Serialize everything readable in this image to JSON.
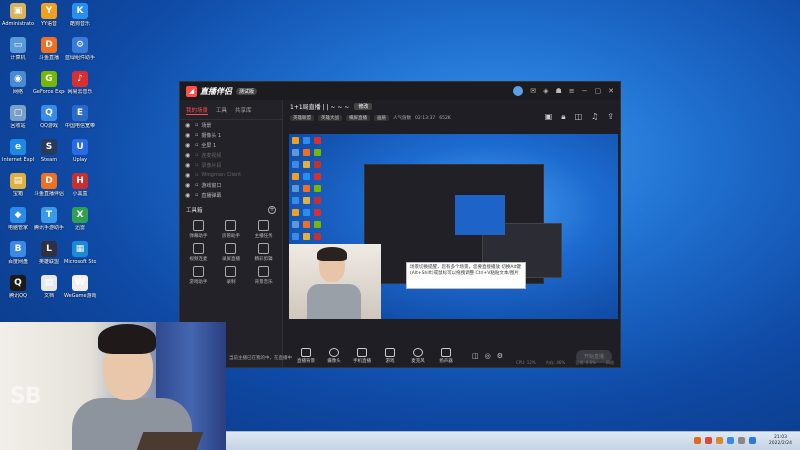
{
  "desktop_icons": [
    {
      "label": "Administrator",
      "color": "#d9b45a",
      "glyph": "▣"
    },
    {
      "label": "YY语音",
      "color": "#f0a020",
      "glyph": "Y"
    },
    {
      "label": "酷狗音乐",
      "color": "#2a8ef0",
      "glyph": "K"
    },
    {
      "label": "计算机",
      "color": "#5a9ad8",
      "glyph": "▭"
    },
    {
      "label": "斗鱼直播",
      "color": "#f07020",
      "glyph": "D"
    },
    {
      "label": "蓝绿组件助手",
      "color": "#3a7ad8",
      "glyph": "⚙"
    },
    {
      "label": "网络",
      "color": "#4a8ad0",
      "glyph": "◉"
    },
    {
      "label": "GeForce Experience",
      "color": "#76b900",
      "glyph": "G"
    },
    {
      "label": "网易云音乐",
      "color": "#d83030",
      "glyph": "♪"
    },
    {
      "label": "回收站",
      "color": "#7aa0c8",
      "glyph": "▢"
    },
    {
      "label": "QQ游戏",
      "color": "#3a8ae8",
      "glyph": "Q"
    },
    {
      "label": "中国电信宽带",
      "color": "#2a6ac8",
      "glyph": "E"
    },
    {
      "label": "Internet Explorer",
      "color": "#1e88e5",
      "glyph": "e"
    },
    {
      "label": "Steam",
      "color": "#2a3a5a",
      "glyph": "S"
    },
    {
      "label": "Uplay",
      "color": "#2a6ae8",
      "glyph": "U"
    },
    {
      "label": "宝箱",
      "color": "#e0b040",
      "glyph": "▤"
    },
    {
      "label": "斗鱼直播伴侣",
      "color": "#f07020",
      "glyph": "D"
    },
    {
      "label": "小黑盒",
      "color": "#c83030",
      "glyph": "H"
    },
    {
      "label": "电脑管家",
      "color": "#2a8ae8",
      "glyph": "◆"
    },
    {
      "label": "腾讯手游助手",
      "color": "#3a9ae8",
      "glyph": "T"
    },
    {
      "label": "迅雷",
      "color": "#30a050",
      "glyph": "X"
    },
    {
      "label": "百度网盘",
      "color": "#3a8ae8",
      "glyph": "B"
    },
    {
      "label": "英雄联盟",
      "color": "#303040",
      "glyph": "L"
    },
    {
      "label": "Microsoft Store",
      "color": "#1a8ad8",
      "glyph": "▦"
    },
    {
      "label": "腾讯QQ",
      "color": "#1a1a1a",
      "glyph": "Q"
    },
    {
      "label": "文档",
      "color": "#e8e8e8",
      "glyph": "▤"
    },
    {
      "label": "WeGame游戏",
      "color": "#f0f0f0",
      "glyph": "W"
    }
  ],
  "app": {
    "name": "直播伴侣",
    "version": "测试版",
    "left_tabs": [
      "我的场景",
      "工具",
      "共享库"
    ],
    "scenes": [
      {
        "label": "场景",
        "dim": false
      },
      {
        "label": "摄像头 1",
        "dim": false
      },
      {
        "label": "全屏 1",
        "dim": false
      },
      {
        "label": "连麦视频",
        "dim": true
      },
      {
        "label": "录像片段",
        "dim": true
      },
      {
        "label": "Wingman Client",
        "dim": true
      },
      {
        "label": "游戏窗口",
        "dim": false
      },
      {
        "label": "直播弹幕",
        "dim": false
      }
    ],
    "tools_header": "工具箱",
    "tools": [
      "弹幕助手",
      "房管助手",
      "主播任务",
      "视频连麦",
      "录屏直播",
      "精彩剪辑",
      "游戏助手",
      "录制",
      "背景音乐"
    ],
    "stream_title": "1+1局直播 | | ~ ~ ~",
    "edit_label": "修改",
    "tags": [
      "英雄联盟",
      "英雄大战",
      "横屏直播",
      "画质",
      "人气值数",
      "02:13:37",
      "652K"
    ],
    "notice_text": "场景切换提醒，您有多个场景，您要直接播放 切换Alt键(Alt+Shift)或鼠标可以拖拽调整 Ctrl+V粘贴文本/图片",
    "controls": [
      "直播背景",
      "摄像头",
      "手机直播",
      "游戏",
      "麦克风",
      "扬声器"
    ],
    "start_label": "开始直播",
    "status_left": "当前主播已在我的中，在直播中",
    "status_items": [
      "CPU: 12%",
      "内存: 46%",
      "丢帧: 0.0%",
      "网络"
    ]
  },
  "webcam": {
    "watermark": "SB"
  },
  "taskbar": {
    "time": "21:03",
    "date": "2022/2/24",
    "tray_colors": [
      "#e06a1a",
      "#d84a3a",
      "#d88a2a",
      "#3a8ae8",
      "#888888",
      "#2a7ad8"
    ]
  }
}
